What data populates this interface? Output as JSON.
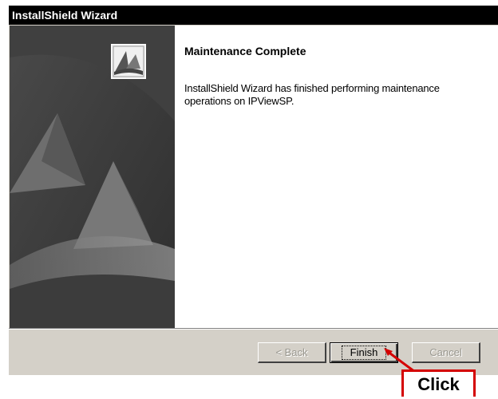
{
  "window": {
    "title": "InstallShield Wizard"
  },
  "content": {
    "heading": "Maintenance Complete",
    "message": "InstallShield Wizard has finished performing maintenance operations on IPViewSP."
  },
  "buttons": {
    "back": "< Back",
    "finish": "Finish",
    "cancel": "Cancel"
  },
  "annotation": {
    "label": "Click",
    "color": "#d40000"
  },
  "icons": {
    "side_logo": "installshield-logo-icon"
  }
}
